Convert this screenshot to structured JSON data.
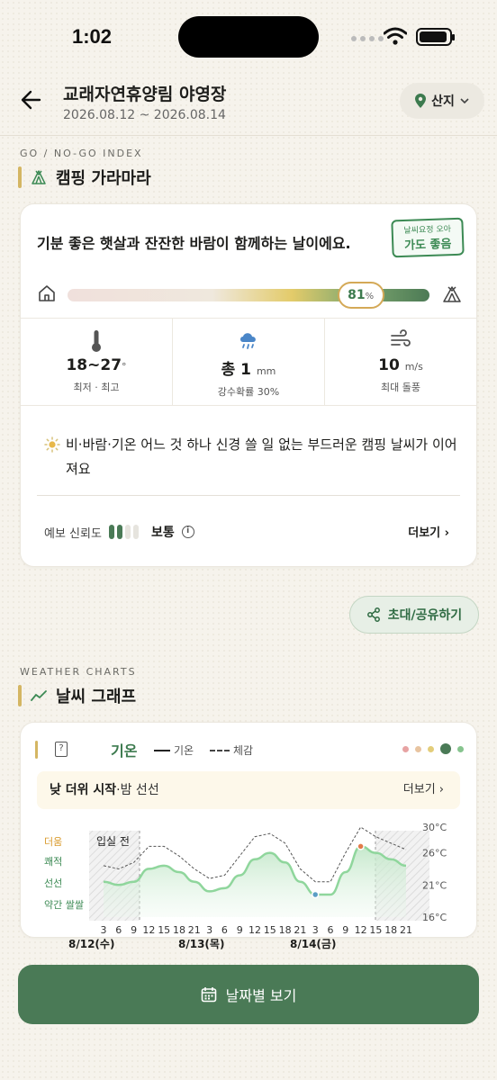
{
  "status_bar": {
    "time": "1:02"
  },
  "header": {
    "title": "교래자연휴양림 야영장",
    "dates": "2026.08.12 ~ 2026.08.14",
    "region": "산지"
  },
  "go_section": {
    "kicker": "GO / NO-GO INDEX",
    "title": "캠핑 가라마라"
  },
  "go_card": {
    "summary": "기분 좋은 햇살과 잔잔한 바람이 함께하는 날이에요.",
    "stamp_top": "날씨요정 오아",
    "stamp_main": "가도 좋음",
    "score": 81,
    "score_unit": "%",
    "stats": [
      {
        "icon": "thermometer-icon",
        "value": "18~27",
        "unit": "°",
        "label": "최저 · 최고"
      },
      {
        "icon": "rain-cloud-icon",
        "value": "총 1",
        "unit": "mm",
        "label": "강수확률 30%"
      },
      {
        "icon": "wind-icon",
        "value": "10",
        "unit": "m/s",
        "label": "최대 돌풍"
      }
    ],
    "description": "비·바람·기온 어느 것 하나 신경 쓸 일 없는 부드러운 캠핑 날씨가 이어져요",
    "reliability_label": "예보 신뢰도",
    "reliability_level": "보통",
    "reliability_bars": [
      1,
      1,
      0,
      0
    ],
    "more": "더보기 ›"
  },
  "share_button": "초대/공유하기",
  "charts_section": {
    "kicker": "WEATHER CHARTS",
    "title": "날씨 그래프"
  },
  "chart_card": {
    "tab_label": "기온",
    "legend_solid": "기온",
    "legend_dashed": "체감",
    "notice_bold": "낮 더위 시작",
    "notice_rest": "·밤 선선",
    "notice_more": "더보기 ›",
    "page_dots": [
      "#e7a3a3",
      "#e8c4a0",
      "#e3cd7a",
      "#4a7a56",
      "#86c48e"
    ],
    "colors": {
      "hot": "#e0a83a",
      "comfortable": "#3c8a54",
      "chill": "#3c8a54",
      "cold": "#3c8a54"
    }
  },
  "chart_data": {
    "type": "line",
    "comfort_bands": [
      "더움",
      "쾌적",
      "선선",
      "약간 쌀쌀"
    ],
    "yticks": [
      "30°C",
      "26°C",
      "21°C",
      "16°C"
    ],
    "ylim": [
      16,
      30
    ],
    "before_checkin_label": "입실 전",
    "xtick_labels": [
      "3",
      "6",
      "9",
      "12",
      "15",
      "18",
      "21",
      "3",
      "6",
      "9",
      "12",
      "15",
      "18",
      "21",
      "3",
      "6",
      "9",
      "12",
      "15",
      "18",
      "21"
    ],
    "day_labels": [
      "8/12(수)",
      "8/13(목)",
      "8/14(금)"
    ],
    "series": [
      {
        "name": "기온",
        "values": [
          21.5,
          21,
          21.5,
          23.5,
          24,
          23,
          21.5,
          20,
          20.5,
          22.5,
          25,
          26,
          24.5,
          21.5,
          19.5,
          19.5,
          23,
          27,
          26,
          25,
          24
        ]
      },
      {
        "name": "체감",
        "values": [
          24,
          23.5,
          24.5,
          27,
          27,
          25.5,
          23.5,
          22,
          22.5,
          25.5,
          28.5,
          29,
          27.5,
          23.5,
          21.5,
          21.5,
          26,
          30,
          28.5,
          27.5,
          26.5
        ]
      }
    ],
    "min_point": 19.5,
    "max_point": 27
  },
  "bottom_button": "날짜별 보기"
}
